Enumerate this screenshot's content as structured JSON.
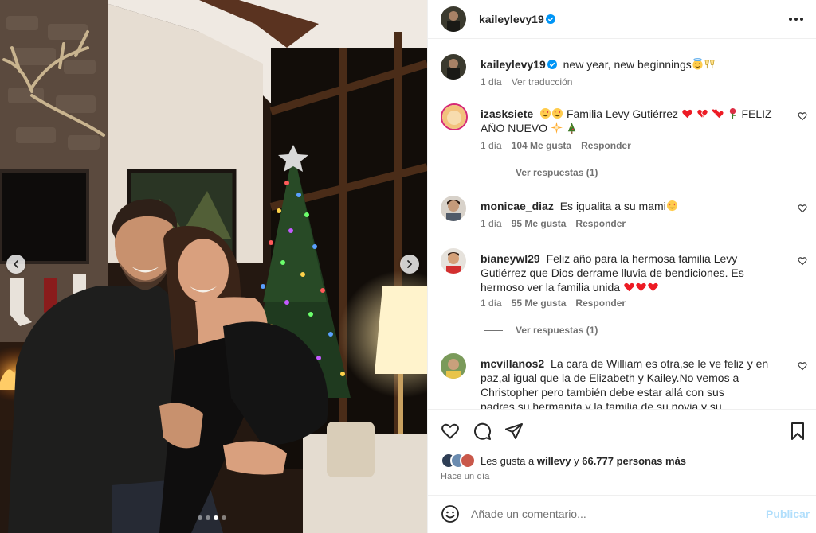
{
  "post": {
    "author": "kaileylevy19",
    "verified": true,
    "caption": {
      "text": "new year, new beginnings",
      "emojis": [
        "smiling-face-with-halo",
        "clinking-glasses"
      ],
      "time": "1 día",
      "translate_label": "Ver traducción"
    }
  },
  "carousel": {
    "total_slides": 4,
    "active_slide": 3
  },
  "comments": [
    {
      "user": "izasksiete",
      "text_before": "Familia Levy Gutiérrez",
      "text_after": "FELIZ AÑO NUEVO",
      "time": "1 día",
      "likes": "104 Me gusta",
      "reply": "Responder",
      "replies": "Ver respuestas (1)"
    },
    {
      "user": "monicae_diaz",
      "text": "Es igualita a su mami",
      "time": "1 día",
      "likes": "95 Me gusta",
      "reply": "Responder"
    },
    {
      "user": "bianeywl29",
      "text": "Feliz año para la hermosa familia Levy Gutiérrez que Dios derrame lluvia de bendiciones. Es hermoso ver la familia unida",
      "time": "1 día",
      "likes": "55 Me gusta",
      "reply": "Responder",
      "replies": "Ver respuestas (1)"
    },
    {
      "user": "mcvillanos2",
      "text": "La cara de William es otra,se le ve feliz y en paz,al igual que la de Elizabeth y Kailey.No vemos a Christopher pero también debe estar allá con sus padres,su hermanita y la familia de su novia y su novia.Gracias Kailey por estas lindas"
    }
  ],
  "likes": {
    "prefix": "Les gusta a",
    "first_user": "willevy",
    "joiner": "y",
    "others": "66.777 personas más"
  },
  "posted_ago": "Hace un día",
  "add_comment": {
    "placeholder": "Añade un comentario...",
    "publish_label": "Publicar"
  },
  "colors": {
    "verified": "#0095f6",
    "publish_disabled": "#b2dffc",
    "heart_red": "#ed1b24"
  }
}
